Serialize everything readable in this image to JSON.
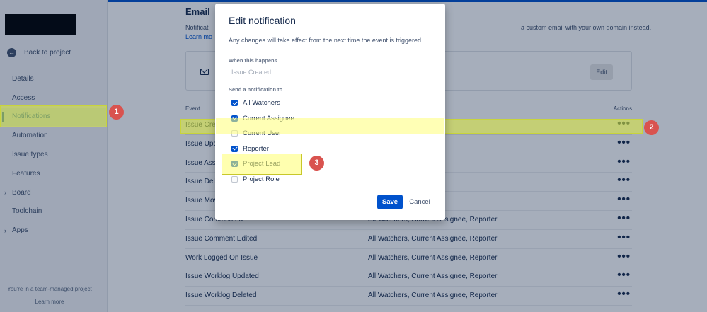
{
  "sidebar": {
    "back_label": "Back to project",
    "items": [
      {
        "label": "Details",
        "chevron": false
      },
      {
        "label": "Access",
        "chevron": false
      },
      {
        "label": "Notifications",
        "chevron": false,
        "active": true
      },
      {
        "label": "Automation",
        "chevron": false
      },
      {
        "label": "Issue types",
        "chevron": false
      },
      {
        "label": "Features",
        "chevron": false
      },
      {
        "label": "Board",
        "chevron": true
      },
      {
        "label": "Toolchain",
        "chevron": false
      },
      {
        "label": "Apps",
        "chevron": true
      }
    ],
    "footer_text": "You're in a team-managed project",
    "footer_link": "Learn more"
  },
  "main": {
    "title": "Email",
    "desc_start": "Notificati",
    "desc_end": "a custom email with your own domain instead.",
    "learn_more": "Learn mo",
    "edit_label": "Edit",
    "columns": {
      "event": "Event",
      "actions": "Actions"
    },
    "rows": [
      {
        "event": "Issue Crea",
        "recipients": "gnee, Reporter"
      },
      {
        "event": "Issue Upd",
        "recipients": "gnee, Reporter"
      },
      {
        "event": "Issue Assi",
        "recipients": "gnee, Reporter"
      },
      {
        "event": "Issue Dele",
        "recipients": "gnee, Reporter"
      },
      {
        "event": "Issue Mov",
        "recipients": "gnee, Reporter"
      },
      {
        "event": "Issue Commented",
        "recipients": "All Watchers, Current Assignee, Reporter"
      },
      {
        "event": "Issue Comment Edited",
        "recipients": "All Watchers, Current Assignee, Reporter"
      },
      {
        "event": "Work Logged On Issue",
        "recipients": "All Watchers, Current Assignee, Reporter"
      },
      {
        "event": "Issue Worklog Updated",
        "recipients": "All Watchers, Current Assignee, Reporter"
      },
      {
        "event": "Issue Worklog Deleted",
        "recipients": "All Watchers, Current Assignee, Reporter"
      }
    ],
    "row_action_icon": "more-horizontal-icon"
  },
  "modal": {
    "title": "Edit notification",
    "description": "Any changes will take effect from the next time the event is triggered.",
    "when_label": "When this happens",
    "event_value": "Issue Created",
    "send_label": "Send a notification to",
    "options": [
      {
        "label": "All Watchers",
        "checked": true
      },
      {
        "label": "Current Assignee",
        "checked": true
      },
      {
        "label": "Current User",
        "checked": false
      },
      {
        "label": "Reporter",
        "checked": true
      },
      {
        "label": "Project Lead",
        "checked": true
      },
      {
        "label": "Project Role",
        "checked": false
      }
    ],
    "save_label": "Save",
    "cancel_label": "Cancel"
  },
  "annotations": [
    "1",
    "2",
    "3"
  ],
  "colors": {
    "accent": "#0052cc",
    "highlight": "#dceb3c",
    "badge": "#d9534f"
  }
}
